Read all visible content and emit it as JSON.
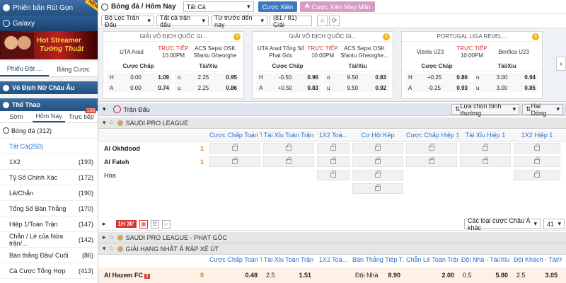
{
  "sidebar": {
    "banner1": "Phiên bản Rút Gọn",
    "banner1_badge": "NEW",
    "banner2": "Galaxy",
    "streamer_line1": "Hot Streamer",
    "streamer_line2": "Tường Thuật",
    "tabs": [
      "Phiếu Đặt ...",
      "Bảng Cược"
    ],
    "section1": "Vô Địch Nữ Châu Âu",
    "section2": "Thể Thao",
    "sub_tabs": [
      "Sớm",
      "Hôm Nay",
      "Trực tiếp"
    ],
    "live_count": "133",
    "sport_label": "Bóng đá",
    "sport_count": "(312)",
    "items": [
      {
        "label": "Tất Cả",
        "count": "(250)"
      },
      {
        "label": "1X2",
        "count": "(193)"
      },
      {
        "label": "Tỷ Số Chính Xác",
        "count": "(172)"
      },
      {
        "label": "Lẻ/Chẵn",
        "count": "(190)"
      },
      {
        "label": "Tổng Số Bàn Thắng",
        "count": "(170)"
      },
      {
        "label": "Hiệp 1/Toàn Trận",
        "count": "(147)"
      },
      {
        "label": "Chẵn / Lẻ của Nửa trận/...",
        "count": "(142)"
      },
      {
        "label": "Bàn thắng Đầu/ Cuối",
        "count": "(86)"
      },
      {
        "label": "Cá Cược Tổng Hợp",
        "count": "(413)"
      },
      {
        "label": "Cược Thắng",
        "count": "(62)"
      }
    ]
  },
  "topbar": {
    "title": "Bóng đá / Hôm Nay",
    "select": "Tất Cả",
    "btn_parlay": "Cược Xiên",
    "btn_lucky": "Cược Xiên May Mắn"
  },
  "filters": {
    "f1": "Bộ Lọc Trận Đấu",
    "f2": "Tất cả trận đấu",
    "f3": "Từ trước đến nay",
    "count": "(81 / 81) Giải"
  },
  "cards": [
    {
      "league": "GIẢI VÔ ĐỊCH QUỐC GI...",
      "home": "UTA Arad",
      "away": "ACS Sepsi OSK Sfantu Gheorghe",
      "status": "TRỰC TIẾP",
      "time": "10:00PM",
      "h_label": "H",
      "a_label": "A",
      "h_hcap": "0.00",
      "h_hodd": "1.09",
      "h_ou": "o",
      "h_oul": "2.25",
      "h_ouo": "0.95",
      "a_hcap": "0.00",
      "a_hodd": "0.74",
      "a_ou": "u",
      "a_oul": "2.25",
      "a_ouo": "0.86"
    },
    {
      "league": "GIẢI VÔ ĐỊCH QUỐC GI...",
      "home": "UTA Arad Tổng Số Phạt Góc",
      "away": "ACS Sepsi OSK Sfantu Gheorghe...",
      "status": "TRỰC TIẾP",
      "time": "10:00PM",
      "h_label": "H",
      "a_label": "A",
      "h_hcap": "-0.50",
      "h_hodd": "0.96",
      "h_ou": "o",
      "h_oul": "9.50",
      "h_ouo": "0.83",
      "a_hcap": "+0.50",
      "a_hodd": "0.83",
      "a_ou": "u",
      "a_oul": "9.50",
      "a_ouo": "0.92"
    },
    {
      "league": "PORTUGAL LIGA REVEL...",
      "home": "Vizela U23",
      "away": "Benfica U23",
      "status": "TRỰC TIẾP",
      "time": "10:00PM",
      "h_label": "H",
      "a_label": "A",
      "h_hcap": "+0.25",
      "h_hodd": "0.86",
      "h_ou": "o",
      "h_oul": "3.00",
      "h_ouo": "0.94",
      "a_hcap": "-0.25",
      "a_hodd": "0.93",
      "a_ou": "u",
      "a_oul": "3.00",
      "a_ouo": "0.85"
    }
  ],
  "card_headers": {
    "handicap": "Cược Chấp",
    "ou": "Tài/Xỉu"
  },
  "section": {
    "label": "Trận Đấu",
    "sort": "Lựa chọn bình thường",
    "view": "Hai Dòng"
  },
  "league1": "SAUDI PRO LEAGUE",
  "columns": [
    "Cược Chấp Toàn T...",
    "Tài Xỉu Toàn Trận",
    "1X2 Toà...",
    "Cơ Hội Kép",
    "Cược Chấp Hiệp 1",
    "Tài Xỉu Hiệp 1",
    "1X2 Hiệp 1"
  ],
  "match": {
    "home": "Al Okhdood",
    "home_score": "1",
    "away": "Al Fateh",
    "away_score": "1",
    "draw": "Hòa",
    "live": "1H 30'"
  },
  "ctrl": {
    "type": "Các loại cược Châu Á khác",
    "num": "41"
  },
  "league2": "SAUDI PRO LEAGUE - PHẠT GÓC",
  "league3": "GIẢI HẠNG NHẤT Ả RẬP XÊ ÚT",
  "columns2": [
    "Cược Chấp Toàn T...",
    "Tài Xỉu Toàn Trận",
    "1X2 Toà...",
    "Bàn Thắng Tiếp T...",
    "Chẵn Lẻ Toàn Trận",
    "Đội Nhà - Tài/Xỉu",
    "Đội Khách - Tài/Xỉu"
  ],
  "row2": {
    "team": "Al Hazem FC",
    "card": "1",
    "score": "0",
    "c1": "0.48",
    "c2a": "2.5",
    "c2b": "1.51",
    "c4a": "Đội Nhà",
    "c4b": "8.90",
    "c5": "2.00",
    "c6a": "0.5",
    "c6b": "5.80",
    "c7a": "2.5",
    "c7b": "3.05"
  }
}
